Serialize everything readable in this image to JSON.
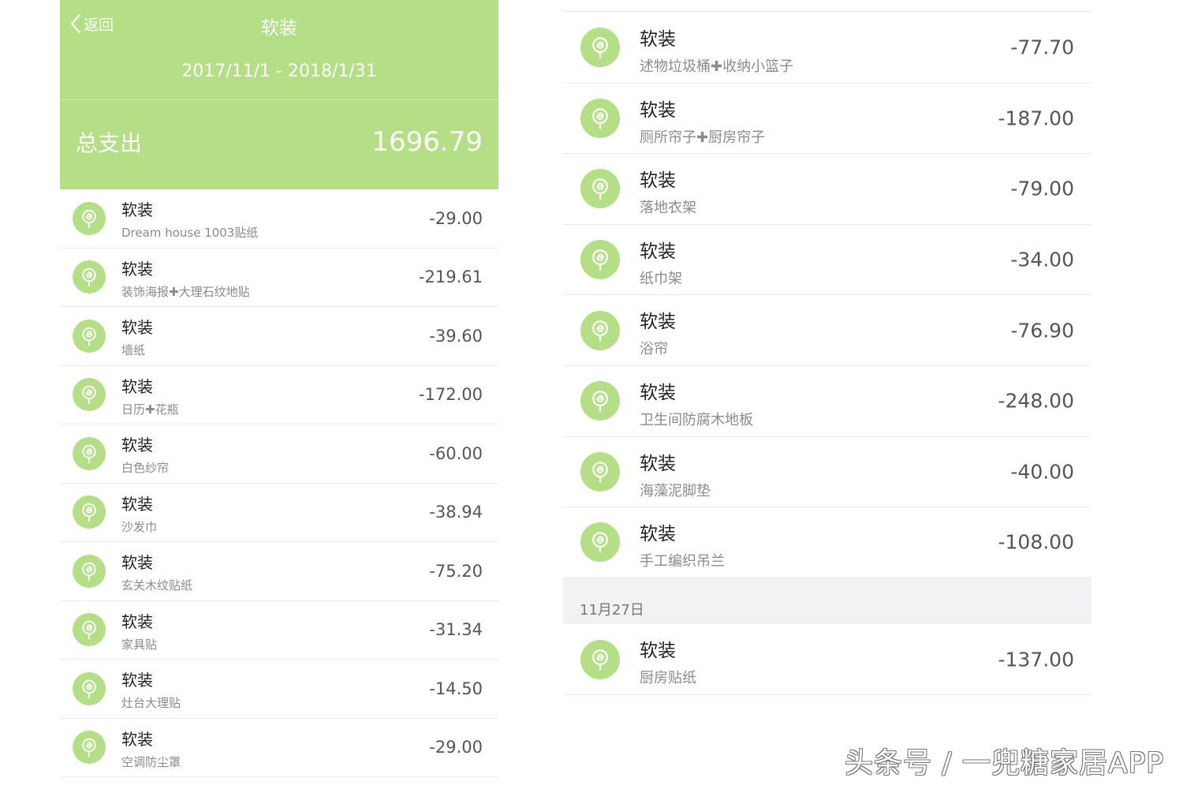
{
  "header": {
    "back_label": "返回",
    "title": "软装",
    "date_range": "2017/11/1 - 2018/1/31",
    "total_label": "总支出",
    "total_value": "1696.79"
  },
  "category_icon": "lollipop-icon",
  "accent_color": "#b4df87",
  "left_items": [
    {
      "title": "软装",
      "subtitle": "Dream house 1003贴纸",
      "amount": "-29.00"
    },
    {
      "title": "软装",
      "subtitle": "装饰海报✚大理石纹地贴",
      "amount": "-219.61"
    },
    {
      "title": "软装",
      "subtitle": "墙纸",
      "amount": "-39.60"
    },
    {
      "title": "软装",
      "subtitle": "日历✚花瓶",
      "amount": "-172.00"
    },
    {
      "title": "软装",
      "subtitle": "白色纱帘",
      "amount": "-60.00"
    },
    {
      "title": "软装",
      "subtitle": "沙发巾",
      "amount": "-38.94"
    },
    {
      "title": "软装",
      "subtitle": "玄关木纹贴纸",
      "amount": "-75.20"
    },
    {
      "title": "软装",
      "subtitle": "家具贴",
      "amount": "-31.34"
    },
    {
      "title": "软装",
      "subtitle": "灶台大理贴",
      "amount": "-14.50"
    },
    {
      "title": "软装",
      "subtitle": "空调防尘罩",
      "amount": "-29.00"
    }
  ],
  "right_items": [
    {
      "title": "软装",
      "subtitle": "述物垃圾桶✚收纳小篮子",
      "amount": "-77.70"
    },
    {
      "title": "软装",
      "subtitle": "厕所帘子✚厨房帘子",
      "amount": "-187.00"
    },
    {
      "title": "软装",
      "subtitle": "落地衣架",
      "amount": "-79.00"
    },
    {
      "title": "软装",
      "subtitle": "纸巾架",
      "amount": "-34.00"
    },
    {
      "title": "软装",
      "subtitle": "浴帘",
      "amount": "-76.90"
    },
    {
      "title": "软装",
      "subtitle": "卫生间防腐木地板",
      "amount": "-248.00"
    },
    {
      "title": "软装",
      "subtitle": "海藻泥脚垫",
      "amount": "-40.00"
    },
    {
      "title": "软装",
      "subtitle": "手工编织吊兰",
      "amount": "-108.00"
    }
  ],
  "date_section": "11月27日",
  "last_item": {
    "title": "软装",
    "subtitle": "厨房贴纸",
    "amount": "-137.00"
  },
  "watermark": "头条号 / 一兜糖家居APP"
}
